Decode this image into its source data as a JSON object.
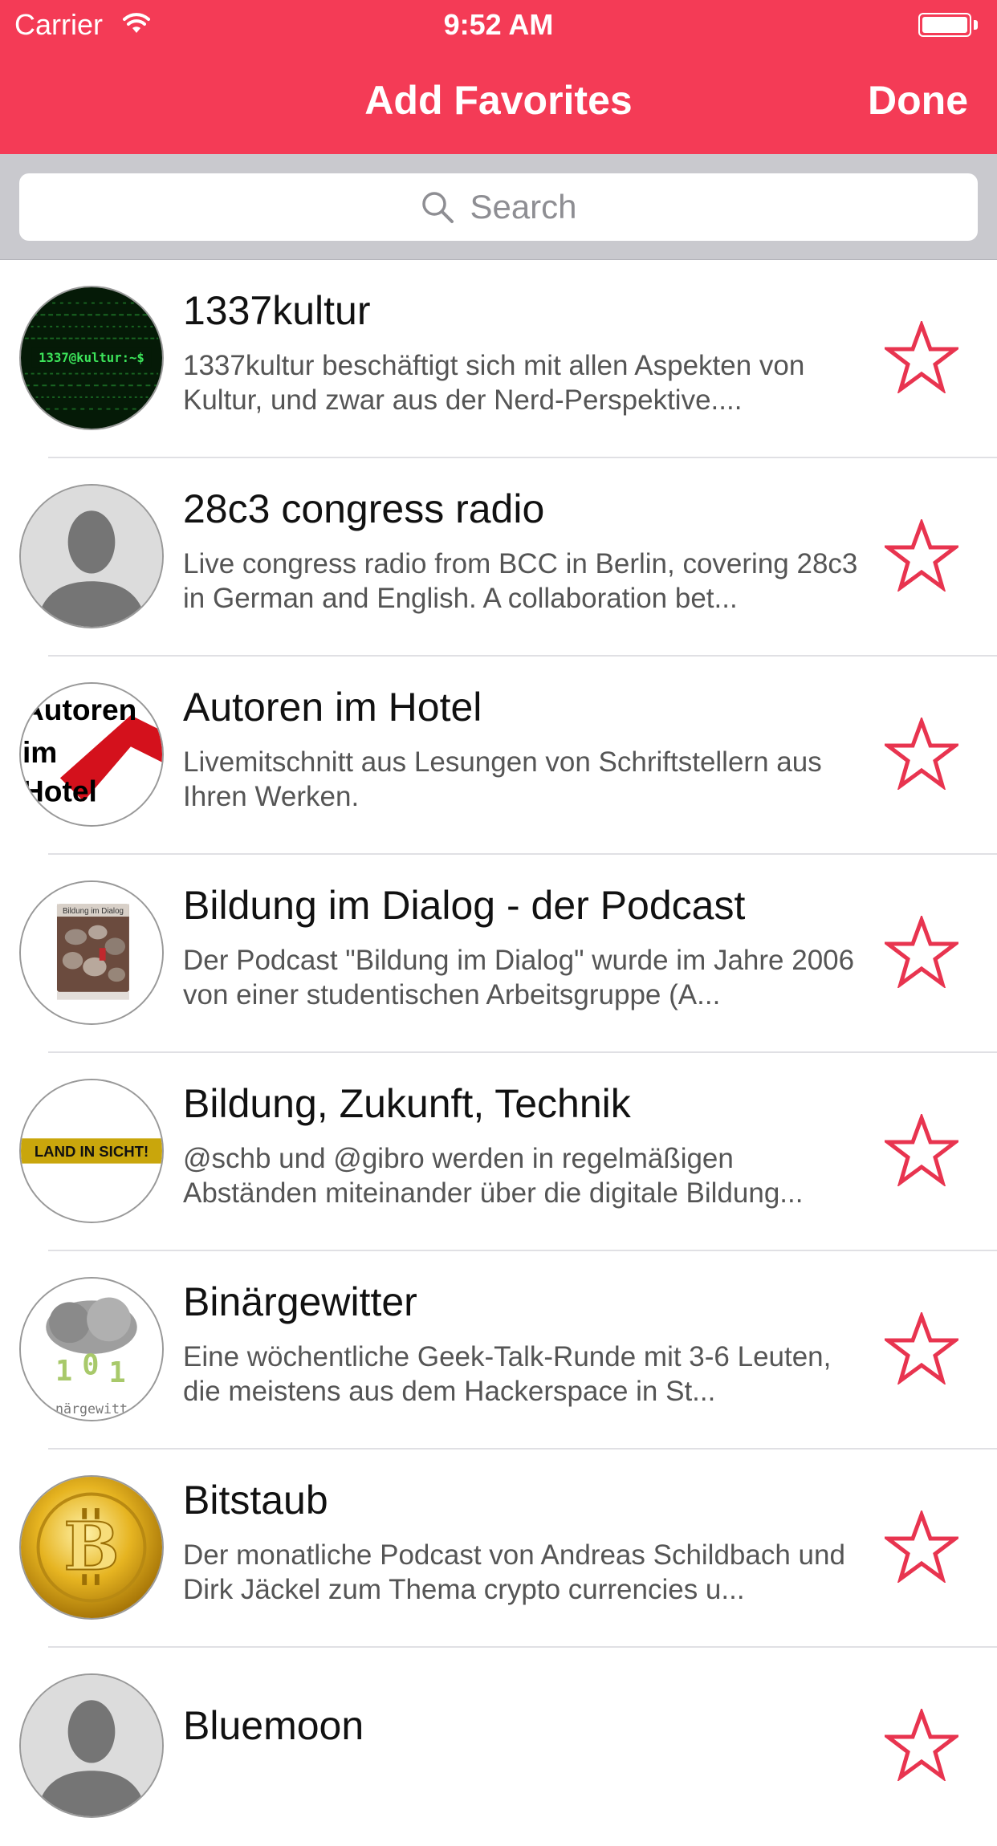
{
  "status": {
    "carrier": "Carrier",
    "time": "9:52 AM"
  },
  "nav": {
    "title": "Add Favorites",
    "done_label": "Done"
  },
  "search": {
    "placeholder": "Search"
  },
  "colors": {
    "accent": "#f43b56",
    "star": "#e8344f"
  },
  "podcasts": [
    {
      "title": "1337kultur",
      "description": "1337kultur beschäftigt sich mit allen Aspekten von Kultur, und zwar aus der Nerd-Perspektive....",
      "avatar_icon": "terminal-avatar-icon",
      "avatar_text": "1337@kultur:~$"
    },
    {
      "title": "28c3 congress radio",
      "description": "Live congress radio from BCC in Berlin, covering 28c3 in German and English. A collaboration bet...",
      "avatar_icon": "person-placeholder-icon"
    },
    {
      "title": "Autoren im Hotel",
      "description": "Livemitschnitt aus Lesungen von Schriftstellern aus Ihren Werken.",
      "avatar_icon": "autoren-logo-icon",
      "avatar_text_1": "Autoren",
      "avatar_text_2": "im",
      "avatar_text_3": "Hotel"
    },
    {
      "title": "Bildung im Dialog - der Podcast",
      "description": "Der Podcast \"Bildung im Dialog\" wurde im Jahre 2006 von einer studentischen Arbeitsgruppe (A...",
      "avatar_icon": "stones-cover-icon",
      "avatar_text": "Bildung im Dialog"
    },
    {
      "title": "Bildung, Zukunft, Technik",
      "description": "@schb und @gibro werden in regelmäßigen Abständen miteinander über die digitale Bildung...",
      "avatar_icon": "land-in-sicht-icon",
      "avatar_text": "LAND IN SICHT!"
    },
    {
      "title": "Binärgewitter",
      "description": "Eine wöchentliche Geek-Talk-Runde mit 3-6 Leuten, die meistens aus dem Hackerspace in St...",
      "avatar_icon": "cloud-storm-icon",
      "avatar_text": "närgewitt"
    },
    {
      "title": "Bitstaub",
      "description": "Der monatliche Podcast von Andreas Schildbach und Dirk Jäckel zum Thema crypto currencies u...",
      "avatar_icon": "bitcoin-coin-icon"
    },
    {
      "title": "Bluemoon",
      "description": "",
      "avatar_icon": "person-placeholder-icon"
    }
  ]
}
